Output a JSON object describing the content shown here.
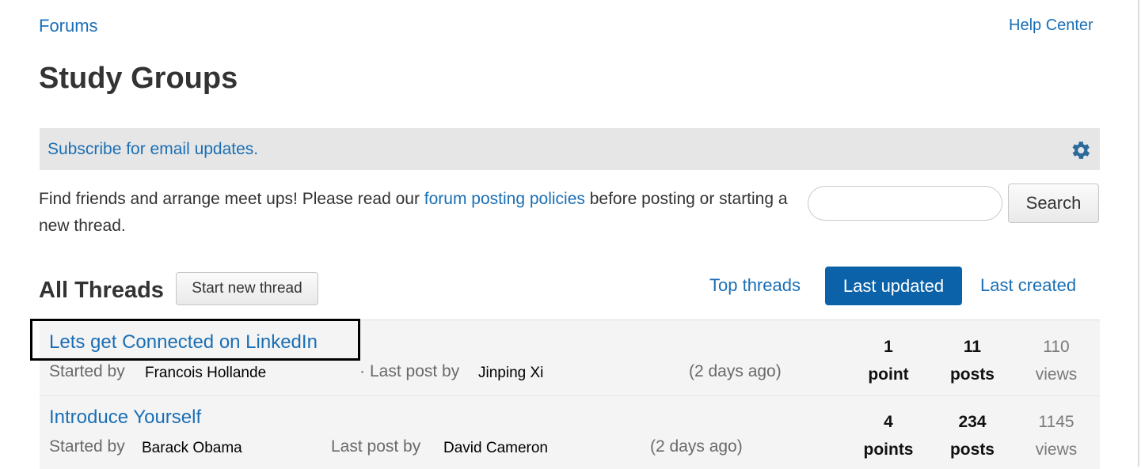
{
  "header": {
    "forums_link": "Forums",
    "help_link": "Help Center",
    "title": "Study Groups"
  },
  "subscribe": {
    "label": "Subscribe for email updates.",
    "icon": "gear-icon"
  },
  "intro": {
    "before": "Find friends and arrange meet ups! Please read our ",
    "link": "forum posting policies",
    "after": " before posting or starting a new thread."
  },
  "search": {
    "value": "",
    "button_label": "Search"
  },
  "threads": {
    "heading": "All Threads",
    "new_thread_label": "Start new thread",
    "tabs": [
      "Top threads",
      "Last updated",
      "Last created"
    ],
    "active_tab": "Last updated",
    "started_by_label": "Started by",
    "last_post_label": "Last post by",
    "rows": [
      {
        "title": "Lets get Connected on LinkedIn",
        "starter": "Francois Hollande",
        "last_poster": "Jinping Xi",
        "time": "(2 days ago)",
        "points": "1",
        "points_label": "point",
        "posts": "11",
        "posts_label": "posts",
        "views": "110",
        "views_label": "views"
      },
      {
        "title": "Introduce Yourself",
        "starter": "Barack Obama",
        "last_poster": "David Cameron",
        "time": "(2 days ago)",
        "points": "4",
        "points_label": "points",
        "posts": "234",
        "posts_label": "posts",
        "views": "1145",
        "views_label": "views"
      }
    ]
  },
  "colors": {
    "link": "#1a6fb5",
    "active_tab": "#0b62a8",
    "subscribe_bar": "#e6e6e6",
    "gear": "#2c6a9a"
  }
}
